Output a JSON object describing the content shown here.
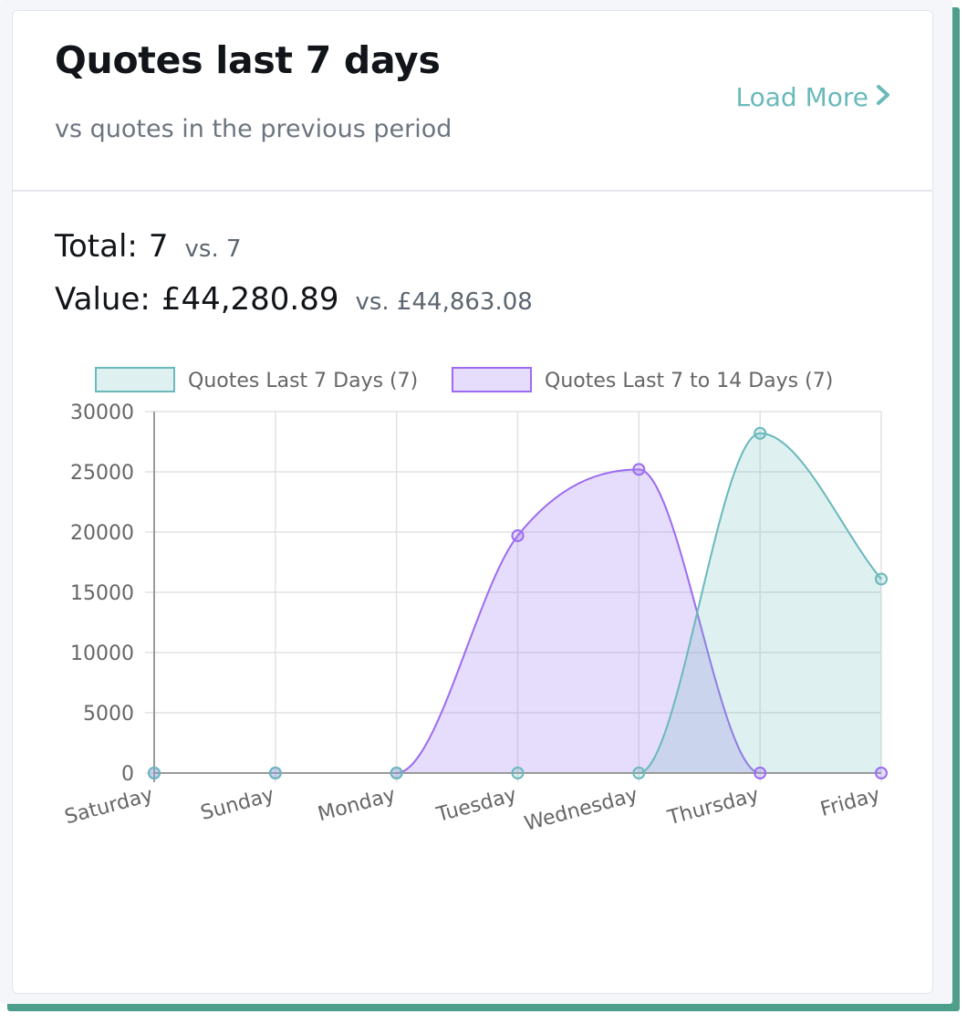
{
  "card": {
    "title": "Quotes last 7 days",
    "subtitle": "vs quotes in the previous period",
    "load_more_label": "Load More"
  },
  "stats": {
    "total_label": "Total:",
    "total_value": "7",
    "total_vs": "vs. 7",
    "value_label": "Value:",
    "value_amount": "£44,280.89",
    "value_vs": "vs. £44,863.08"
  },
  "colors": {
    "accent": "#6ab9bb",
    "current_series": "#6ab9bb",
    "current_fill": "rgba(106,185,187,0.22)",
    "previous_series": "#9b6cf0",
    "previous_fill": "rgba(160,118,244,0.26)",
    "shadow": "#4d9e8a"
  },
  "icons": {
    "load_more": "chevron-right-icon"
  },
  "chart_data": {
    "type": "area",
    "categories": [
      "Saturday",
      "Sunday",
      "Monday",
      "Tuesday",
      "Wednesday",
      "Thursday",
      "Friday"
    ],
    "series": [
      {
        "name": "Quotes Last 7 Days (7)",
        "values": [
          0,
          0,
          0,
          0,
          0,
          28200,
          16100
        ]
      },
      {
        "name": "Quotes Last 7 to 14 Days (7)",
        "values": [
          0,
          0,
          0,
          19700,
          25200,
          0,
          0
        ]
      }
    ],
    "yticks": [
      "0",
      "5000",
      "10000",
      "15000",
      "20000",
      "25000",
      "30000"
    ],
    "ylim": [
      0,
      30000
    ],
    "grid": true,
    "legend": "top",
    "smooth": true
  }
}
